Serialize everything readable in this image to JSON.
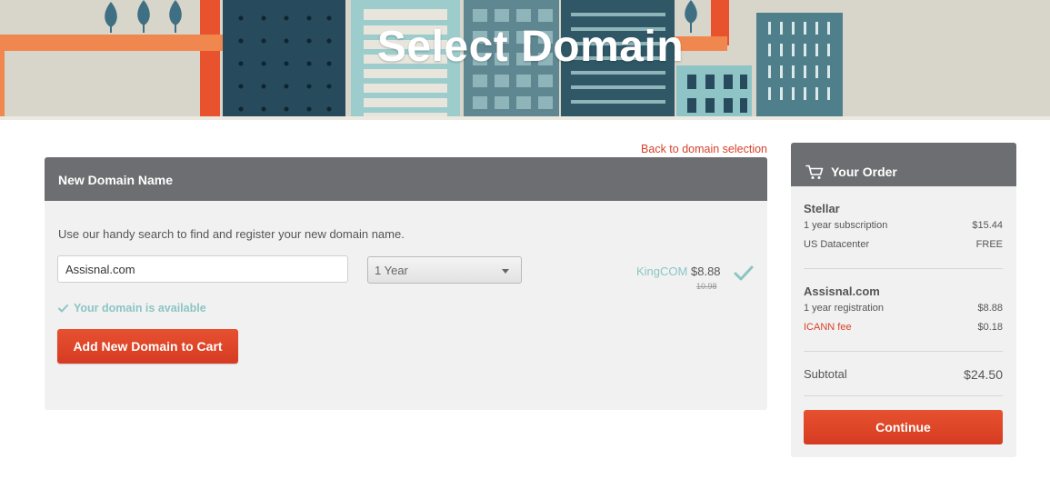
{
  "hero": {
    "title": "Select Domain"
  },
  "back_link": "Back to domain selection",
  "domain_panel": {
    "header": "New Domain Name",
    "intro": "Use our handy search to find and register your new domain name.",
    "domain_input_value": "Assisnal.com",
    "term_select_value": "1 Year",
    "registrar": "KingCOM",
    "price": "$8.88",
    "old_price": "10.98",
    "availability": "Your domain is available",
    "add_button": "Add New Domain to Cart"
  },
  "order": {
    "header": "Your Order",
    "plan": {
      "name": "Stellar",
      "lines": [
        {
          "label": "1 year subscription",
          "amount": "$15.44"
        },
        {
          "label": "US Datacenter",
          "amount": "FREE"
        }
      ]
    },
    "domain": {
      "name": "Assisnal.com",
      "lines": [
        {
          "label": "1 year registration",
          "amount": "$8.88"
        },
        {
          "label": "ICANN fee",
          "amount": "$0.18"
        }
      ]
    },
    "subtotal_label": "Subtotal",
    "subtotal_amount": "$24.50",
    "continue_button": "Continue"
  },
  "icons": {
    "cart": "cart-icon",
    "check": "check-icon",
    "caret": "chevron-down-icon"
  },
  "colors": {
    "accent": "#d9412b",
    "header_gray": "#6d6e71",
    "panel_bg": "#f1f1f1",
    "available_teal": "#8cc5c4"
  }
}
